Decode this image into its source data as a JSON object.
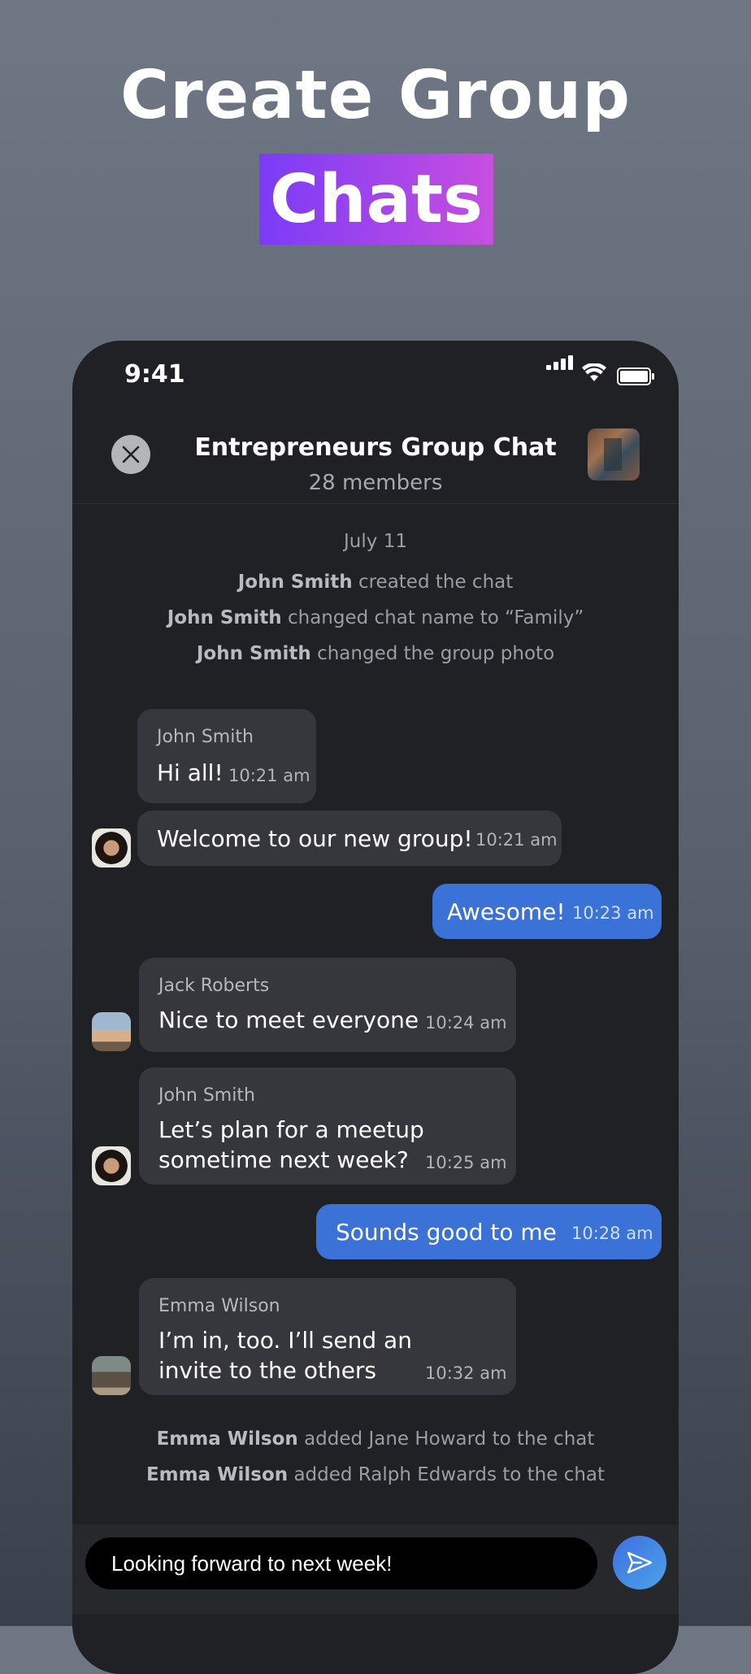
{
  "hero": {
    "line1": "Create Group",
    "line2": "Chats"
  },
  "status": {
    "time": "9:41"
  },
  "header": {
    "title": "Entrepreneurs Group Chat",
    "subtitle": "28 members"
  },
  "system_top": {
    "date": "July 11",
    "events": [
      {
        "name": "John Smith",
        "text": " created the chat"
      },
      {
        "name": "John Smith",
        "text": " changed chat name to  “Family”"
      },
      {
        "name": "John Smith",
        "text": " changed the group photo"
      }
    ]
  },
  "messages": [
    {
      "sender": "John Smith",
      "text": "Hi all!",
      "time": "10:21 am"
    },
    {
      "text": "Welcome to our new group!",
      "time": "10:21 am"
    },
    {
      "text": "Awesome!",
      "time": "10:23 am"
    },
    {
      "sender": "Jack Roberts",
      "text": "Nice to meet everyone",
      "time": "10:24 am"
    },
    {
      "sender": "John Smith",
      "line1": "Let’s plan for a meetup",
      "line2": "sometime next week?",
      "time": "10:25 am"
    },
    {
      "text": "Sounds good to me",
      "time": "10:28 am"
    },
    {
      "sender": "Emma Wilson",
      "line1": "I’m in, too. I’ll send an",
      "line2": "invite to the others",
      "time": "10:32 am"
    }
  ],
  "system_bottom": [
    {
      "name": "Emma Wilson",
      "text": " added Jane Howard to the chat"
    },
    {
      "name": "Emma Wilson",
      "text": " added Ralph Edwards to the chat"
    }
  ],
  "composer": {
    "value": "Looking forward to next week!"
  },
  "icons": {
    "close": "close-icon",
    "send": "send-icon",
    "signal": "signal-icon",
    "wifi": "wifi-icon",
    "battery": "battery-icon"
  },
  "colors": {
    "accent_gradient_start": "#7a3cf6",
    "accent_gradient_end": "#c84ee0",
    "outgoing_bubble": "#3a72d8",
    "incoming_bubble": "#35373c"
  }
}
